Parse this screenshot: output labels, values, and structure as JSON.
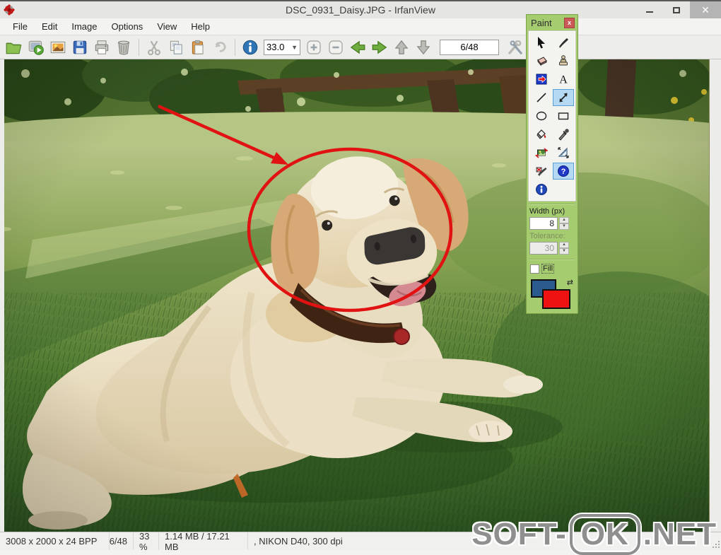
{
  "window": {
    "title": "DSC_0931_Daisy.JPG - IrfanView",
    "app_icon": "irfanview-flower-icon",
    "controls": [
      "minimize-icon",
      "maximize-icon",
      "close-icon"
    ]
  },
  "menu": {
    "items": [
      {
        "label": "File"
      },
      {
        "label": "Edit"
      },
      {
        "label": "Image"
      },
      {
        "label": "Options"
      },
      {
        "label": "View"
      },
      {
        "label": "Help"
      }
    ]
  },
  "toolbar": {
    "zoom_value": "33.0",
    "counter_value": "6/48",
    "icons": [
      "open-folder-icon",
      "slideshow-icon",
      "thumbnails-icon",
      "save-icon",
      "print-icon",
      "delete-icon",
      "cut-icon",
      "copy-icon",
      "paste-icon",
      "undo-icon",
      "info-icon",
      "zoom-in-icon",
      "zoom-out-icon",
      "prev-image-icon",
      "next-image-icon",
      "prev-page-icon",
      "next-page-icon",
      "properties-icon",
      "favorites-star-icon"
    ]
  },
  "paint_panel": {
    "title": "Paint",
    "close_icon": "close-icon",
    "tools": [
      "pointer-tool",
      "brush-tool",
      "eraser-tool",
      "clone-tool",
      "insert-arrow-tool",
      "text-tool",
      "line-tool",
      "arrow-line-tool",
      "ellipse-tool",
      "rectangle-tool",
      "fill-tool",
      "color-picker-tool",
      "straighten-tool",
      "measure-tool",
      "red-eye-tool",
      "help-button",
      "info-button"
    ],
    "selected_tool": "arrow-line-tool",
    "width_label": "Width (px)",
    "width_value": "8",
    "tolerance_label": "Tolerance:",
    "tolerance_value": "30",
    "fill_label": "Fill",
    "swatch_colors": {
      "back": "#2a5a8e",
      "front": "#ee1212"
    },
    "swap_icon": "swap-colors-icon"
  },
  "status_bar": {
    "dimensions": "3008 x 2000 x 24 BPP",
    "index": "6/48",
    "zoom": "33 %",
    "file_size": "1.14 MB / 17.21 MB",
    "camera_info": ", NIKON D40, 300 dpi"
  },
  "watermark": {
    "prefix": "SOFT-",
    "boxed": "OK",
    "suffix": ".NET"
  },
  "colors": {
    "panel_green": "#a6cc70",
    "annotation_red": "#e01212",
    "selection_blue": "#b5d9f2",
    "titlebar_grey": "#e5e5e3"
  }
}
